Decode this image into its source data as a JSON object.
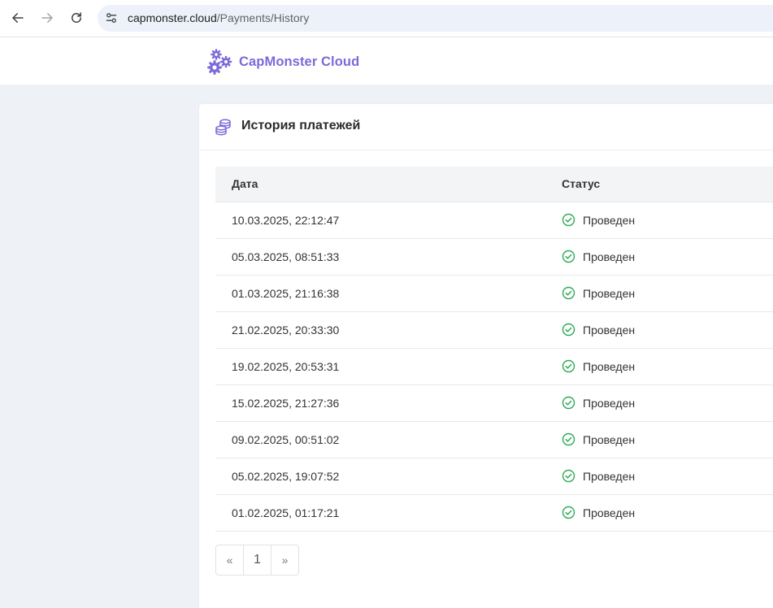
{
  "browser": {
    "url_host": "capmonster.cloud",
    "url_path": "/Payments/History"
  },
  "site": {
    "logo_text": "CapMonster Cloud",
    "brand_color": "#7c6ad9"
  },
  "card": {
    "title": "История платежей",
    "title_icon": "coins-stack-icon"
  },
  "table": {
    "columns": [
      "Дата",
      "Статус"
    ],
    "rows": [
      {
        "date": "10.03.2025, 22:12:47",
        "status": "Проведен"
      },
      {
        "date": "05.03.2025, 08:51:33",
        "status": "Проведен"
      },
      {
        "date": "01.03.2025, 21:16:38",
        "status": "Проведен"
      },
      {
        "date": "21.02.2025, 20:33:30",
        "status": "Проведен"
      },
      {
        "date": "19.02.2025, 20:53:31",
        "status": "Проведен"
      },
      {
        "date": "15.02.2025, 21:27:36",
        "status": "Проведен"
      },
      {
        "date": "09.02.2025, 00:51:02",
        "status": "Проведен"
      },
      {
        "date": "05.02.2025, 19:07:52",
        "status": "Проведен"
      },
      {
        "date": "01.02.2025, 01:17:21",
        "status": "Проведен"
      }
    ],
    "status_color": "#2eaa57"
  },
  "pagination": {
    "prev": "«",
    "current": "1",
    "next": "»"
  }
}
